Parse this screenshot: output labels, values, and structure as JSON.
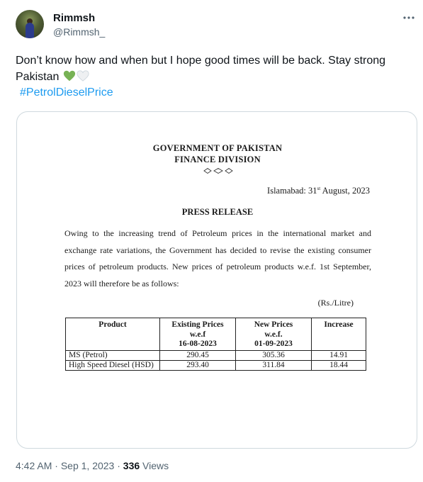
{
  "author": {
    "display_name": "Rimmsh",
    "handle": "@Rimmsh_"
  },
  "tweet": {
    "text": "Don’t know how and when but I hope good times will be back. Stay strong Pakistan",
    "hearts": [
      "green-heart-icon",
      "white-heart-icon"
    ],
    "hashtag": "#PetrolDieselPrice"
  },
  "document": {
    "heading_1": "GOVERNMENT OF PAKISTAN",
    "heading_2": "FINANCE DIVISION",
    "place_date_prefix": "Islamabad: 31",
    "place_date_sup": "st",
    "place_date_suffix": " August, 2023",
    "title": "PRESS RELEASE",
    "paragraph": "Owing to the increasing trend of Petroleum prices in the international market and exchange rate variations, the Government has decided to revise the existing consumer prices of petroleum products. New prices of petroleum products w.e.f. 1st September, 2023 will therefore be as follows:",
    "unit": "(Rs./Litre)",
    "table": {
      "headers": [
        "Product",
        "Existing Prices w.e.f 16-08-2023",
        "New Prices w.e.f. 01-09-2023",
        "Increase"
      ],
      "header_lines": [
        [
          "Product"
        ],
        [
          "Existing Prices",
          "w.e.f",
          "16-08-2023"
        ],
        [
          "New Prices",
          "w.e.f.",
          "01-09-2023"
        ],
        [
          "Increase"
        ]
      ],
      "rows": [
        [
          "MS (Petrol)",
          "290.45",
          "305.36",
          "14.91"
        ],
        [
          "High Speed Diesel (HSD)",
          "293.40",
          "311.84",
          "18.44"
        ]
      ]
    }
  },
  "meta": {
    "time": "4:42 AM",
    "separator": "·",
    "date": "Sep 1, 2023",
    "views_count": "336",
    "views_label": "Views"
  },
  "colors": {
    "link": "#1d9bf0",
    "secondary_text": "#536471",
    "green_heart": "#77b255"
  }
}
